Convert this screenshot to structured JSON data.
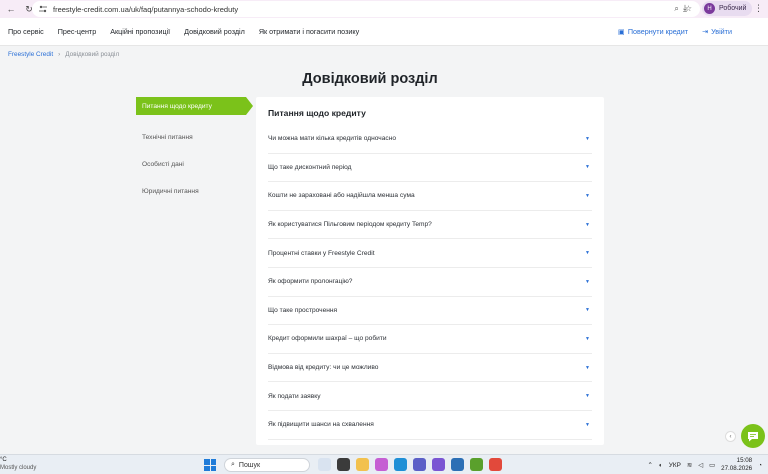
{
  "browser": {
    "url": "freestyle-credit.com.ua/uk/faq/putannya-schodo-kreduty",
    "profile_initial": "Н",
    "profile_label": "Робочий"
  },
  "header": {
    "nav": [
      "Про сервіс",
      "Прес-центр",
      "Акційні пропозиції",
      "Довідковий розділ",
      "Як отримати і погасити позику"
    ],
    "return_credit": "Повернути кредит",
    "login": "Увійти"
  },
  "breadcrumb": {
    "home": "Freestyle Credit",
    "current": "Довідковий розділ"
  },
  "page_title": "Довідковий розділ",
  "sidebar": {
    "items": [
      {
        "label": "Питання щодо кредиту",
        "active": true
      },
      {
        "label": "Технічні питання",
        "active": false
      },
      {
        "label": "Особисті дані",
        "active": false
      },
      {
        "label": "Юридичні питання",
        "active": false
      }
    ]
  },
  "faq": {
    "title": "Питання щодо кредиту",
    "items": [
      "Чи можна мати кілька кредитів одночасно",
      "Що таке дисконтний період",
      "Кошти не зараховані або надійшла менша сума",
      "Як користуватися Пільговим періодом кредиту Temp?",
      "Процентні ставки у Freestyle Credit",
      "Як оформити пролонгацію?",
      "Що таке прострочення",
      "Кредит оформили шахраї – що робити",
      "Відмова від кредиту: чи це можливо",
      "Як подати заявку",
      "Як підвищити шанси на схвалення"
    ]
  },
  "taskbar": {
    "temperature": "°C",
    "weather": "Mostly cloudy",
    "search": "Пошук",
    "lang": "УКР",
    "time": "15:08",
    "date": "27.08.2026"
  },
  "colors": {
    "accent_green": "#7bc21a",
    "link_blue": "#2a6fd6"
  }
}
